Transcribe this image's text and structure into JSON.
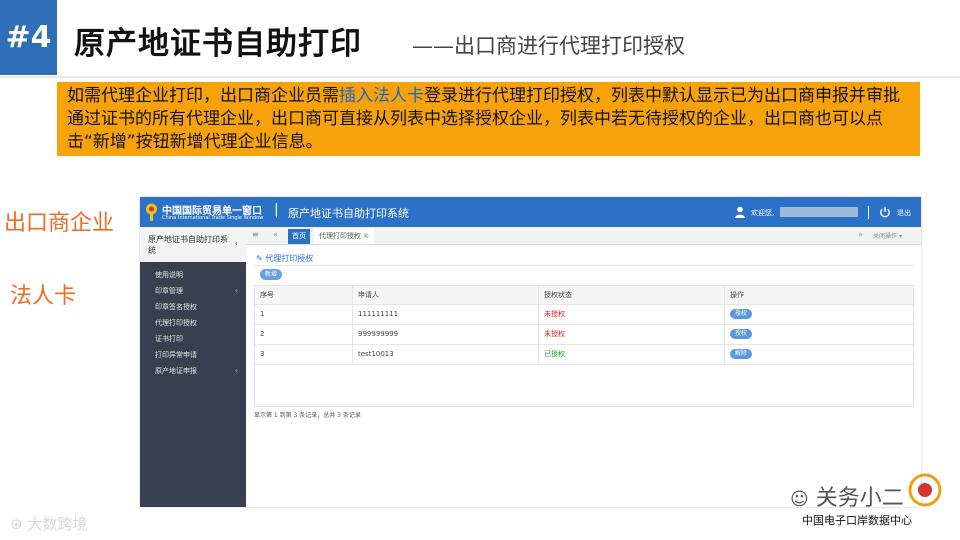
{
  "slide": {
    "number": "#4",
    "title": "原产地证书自助打印",
    "subtitle": "——出口商进行代理打印授权",
    "note": {
      "part1": "如需代理企业打印，出口商企业员需",
      "highlight": "插入法人卡",
      "part2": "登录进行代理打印授权，列表中默认显示已为出口商申报并审批通过证书的所有代理企业，出口商可直接从列表中选择授权企业，列表中若无待授权的企业，出口商也可以点击“新增”按钮新增代理企业信息。"
    },
    "side_label_1": "出口商企业",
    "side_label_2": "法人卡",
    "colors": {
      "badge": "#2f6fb7",
      "note_bg": "#f7a20a",
      "highlight": "#1f66c8",
      "side_label": "#ef6a25"
    }
  },
  "app": {
    "header": {
      "logo_text": "中国国际贸易单一窗口",
      "logo_subtext": "China International Trade Single Window",
      "separator": "|",
      "system_title": "原产地证书自助打印系统",
      "welcome": "欢迎您,",
      "logout": "退出",
      "bar_color": "#2b71c7"
    },
    "sidebar": {
      "header": "原产地证书自助打印系统",
      "items": [
        {
          "label": "使用说明"
        },
        {
          "label": "印章管理",
          "arrow": "‹"
        },
        {
          "label": "印章签名授权"
        },
        {
          "label": "代理打印授权"
        },
        {
          "label": "证书打印"
        },
        {
          "label": "打印异常申请"
        },
        {
          "label": "原产地证申报",
          "arrow": "‹"
        }
      ]
    },
    "tabs": {
      "home": "首页",
      "active": "代理打印授权",
      "close_ops": "关闭操作"
    },
    "section_title": "代理打印授权",
    "add_button": "新增",
    "table": {
      "columns": [
        "序号",
        "申请人",
        "授权状态",
        "操作"
      ],
      "rows": [
        {
          "no": "1",
          "applicant": "111111111",
          "status": "未授权",
          "status_color": "#e02020",
          "action": "授权"
        },
        {
          "no": "2",
          "applicant": "999999999",
          "status": "未授权",
          "status_color": "#e02020",
          "action": "授权"
        },
        {
          "no": "3",
          "applicant": "test10013",
          "status": "已授权",
          "status_color": "#22a022",
          "action": "解除"
        }
      ]
    },
    "pager_text": "显示第 1 到第 3 条记录，总共 3 条记录"
  },
  "watermarks": {
    "left": "大数跨境",
    "wechat": "关务小二",
    "center": "中国电子口岸数据中心"
  }
}
